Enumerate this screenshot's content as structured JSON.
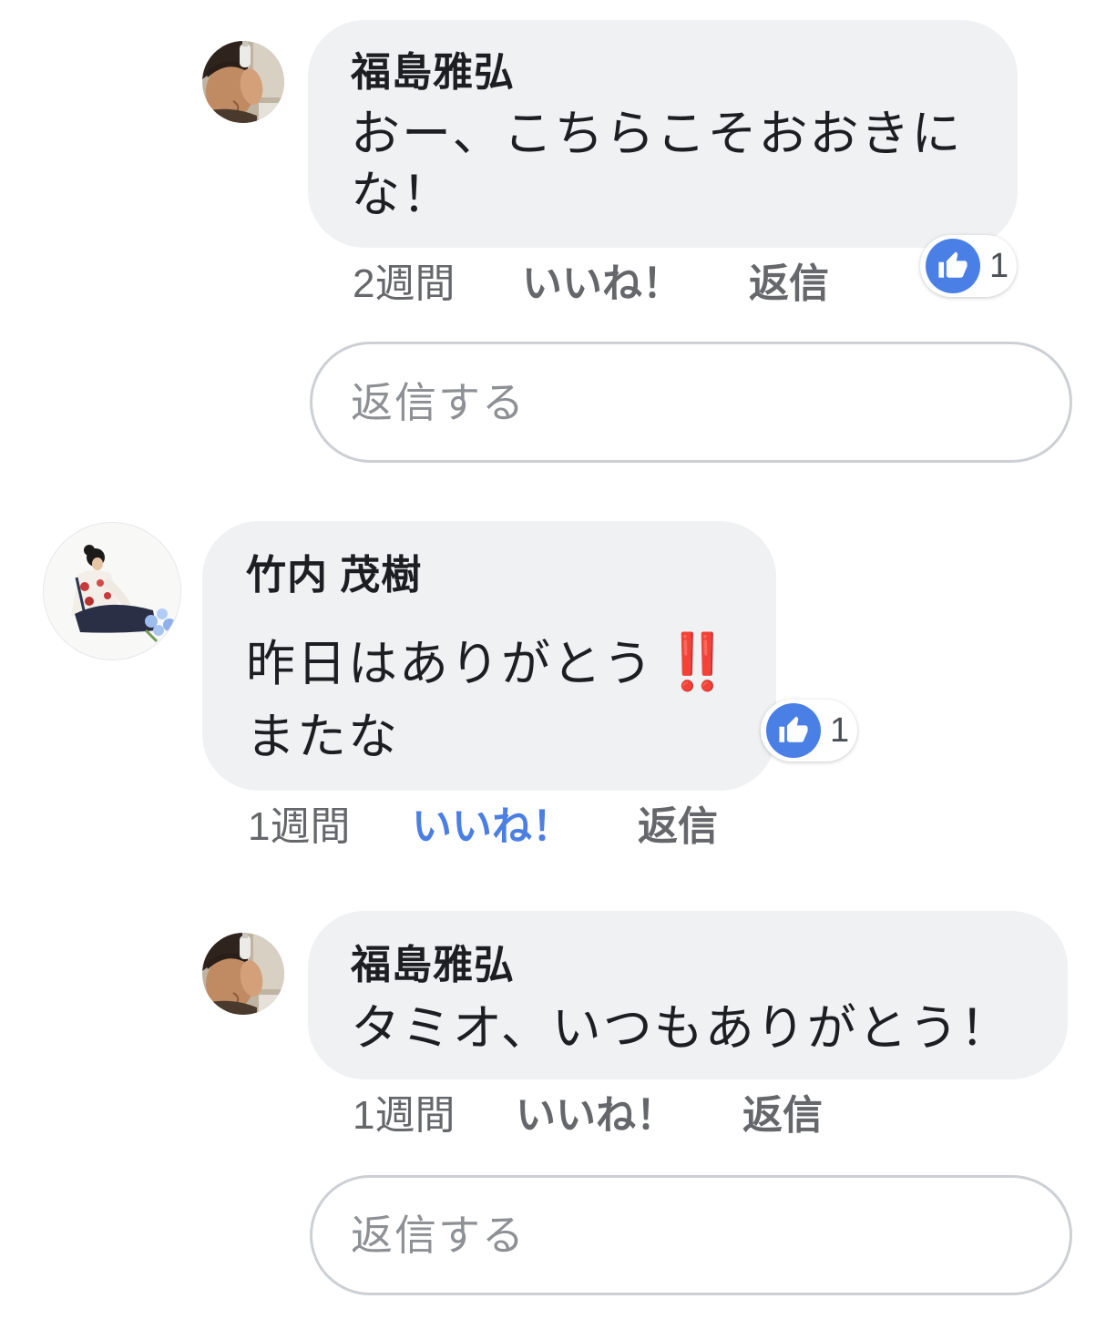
{
  "colors": {
    "page_bg": "#ffffff",
    "bubble_bg": "#f0f1f3",
    "text_primary": "#1c1e21",
    "text_meta": "#65676b",
    "like_active": "#4b7fe3",
    "reaction_badge": "#4a80e6",
    "emoji_red": "#e0141c",
    "input_border": "#ccd0d5",
    "placeholder": "#8d9095"
  },
  "thread": [
    {
      "author": "福島雅弘",
      "message_lines": [
        "おー、こちらこそおおきに",
        "な！"
      ],
      "reaction": {
        "icon": "thumbs-up-icon",
        "count": "1"
      },
      "actions": {
        "time": "2週間",
        "like": "いいね！",
        "like_active": false,
        "reply": "返信"
      }
    },
    {
      "author": "竹内 茂樹",
      "message_lines": [
        "昨日はありがとう",
        "またな"
      ],
      "message_emoji": "‼️",
      "reaction": {
        "icon": "thumbs-up-icon",
        "count": "1"
      },
      "actions": {
        "time": "1週間",
        "like": "いいね！",
        "like_active": true,
        "reply": "返信"
      }
    },
    {
      "author": "福島雅弘",
      "message_lines": [
        "タミオ、いつもありがとう！"
      ],
      "actions": {
        "time": "1週間",
        "like": "いいね！",
        "like_active": false,
        "reply": "返信"
      }
    }
  ],
  "reply_boxes": [
    {
      "placeholder": "返信する"
    },
    {
      "placeholder": "返信する"
    }
  ]
}
